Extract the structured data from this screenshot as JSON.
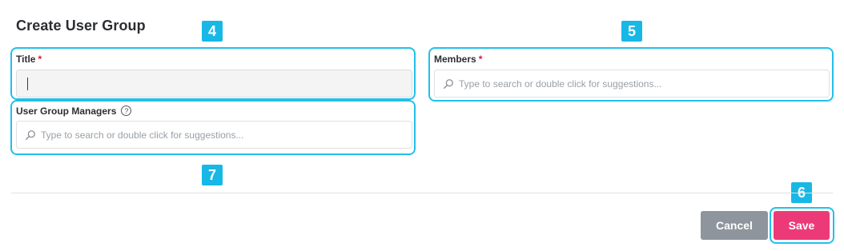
{
  "page": {
    "title": "Create User Group"
  },
  "badges": [
    "4",
    "5",
    "6",
    "7"
  ],
  "form": {
    "title_field": {
      "label": "Title",
      "required_mark": "*",
      "value": ""
    },
    "members_field": {
      "label": "Members",
      "required_mark": "*",
      "placeholder": "Type to search or double click for suggestions..."
    },
    "managers_field": {
      "label": "User Group Managers",
      "help": "?",
      "placeholder": "Type to search or double click for suggestions..."
    }
  },
  "actions": {
    "cancel_label": "Cancel",
    "save_label": "Save"
  },
  "colors": {
    "highlight": "#22c0ea",
    "badge": "#17b8e6",
    "save": "#ec3a78",
    "cancel": "#8f959d",
    "required": "#e0123c"
  },
  "icons": {
    "search": "search-icon",
    "help": "help-circle-icon"
  }
}
